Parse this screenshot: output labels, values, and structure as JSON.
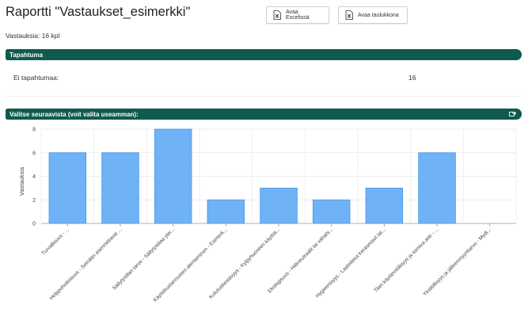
{
  "page": {
    "title": "Raportti \"Vastaukset_esimerkki\"",
    "response_count": "Vastauksia: 16 kpl"
  },
  "toolbar": {
    "excel_label": "Avaa Excelissä",
    "table_label": "Avaa taulukkona",
    "excel_icon": "excel-file-icon",
    "table_icon": "table-file-icon"
  },
  "event_section": {
    "header": "Tapahtuma",
    "rows": [
      {
        "label": "Ei tapahtumaa:",
        "value": "16"
      }
    ]
  },
  "choice_section": {
    "header": "Valitse seuraavista (voit valita useamman):",
    "header_icon": "export-icon"
  },
  "colors": {
    "header_bg": "#0f5a4e",
    "bar_fill": "#6fb2f6",
    "bar_stroke": "#4a97e6"
  },
  "chart_data": {
    "type": "bar",
    "ylabel": "Vastauksia",
    "xlabel": "",
    "ylim": [
      0,
      8
    ],
    "yticks": [
      0,
      2,
      4,
      6,
      8
    ],
    "categories": [
      "Turvallisuus - ...",
      "Helppohoitoisuus - Seinään asennettavat ...",
      "Säilytystilan tarve - Säilytystilaa ylei...",
      "Käyttökustannusten alentaminen - Esimerk...",
      "Kulutuskestävyys - Kylpyhuoneen käyttöt...",
      "Ekologisuus - Hiilineutraalit tai vähähi...",
      "Hygieenisyys - Laatoitetut kerasmiset lat...",
      "Tilan käytännöllisyys ja toimiva arki - ...",
      "Yksilöllisyys ja jälleenmyyntiarvo - Mydi..."
    ],
    "values": [
      6,
      6,
      8,
      2,
      3,
      2,
      3,
      6,
      0
    ],
    "grid": true
  }
}
